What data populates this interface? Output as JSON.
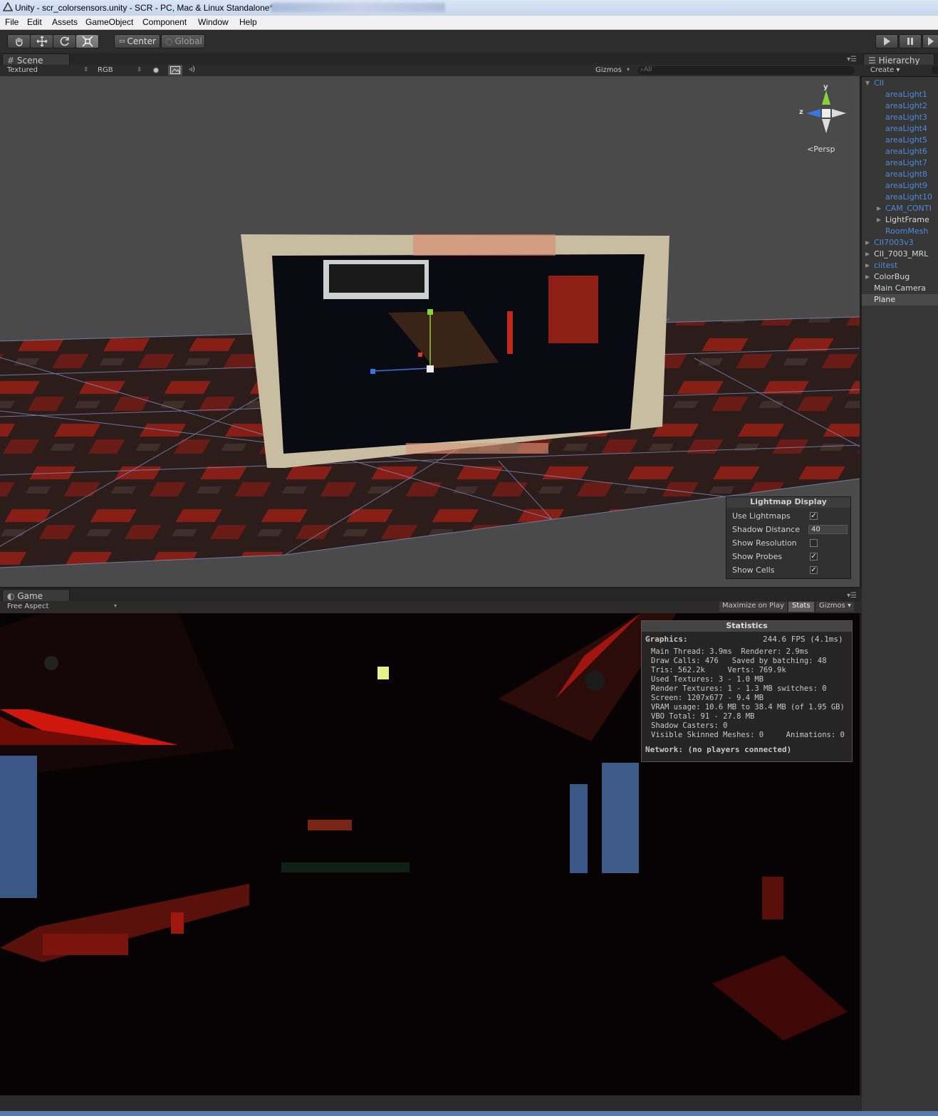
{
  "window": {
    "title": "Unity - scr_colorsensors.unity - SCR - PC, Mac & Linux Standalone*"
  },
  "menu": {
    "items": [
      "File",
      "Edit",
      "Assets",
      "GameObject",
      "Component",
      "Window",
      "Help"
    ]
  },
  "toolbar": {
    "tools": [
      "hand-icon",
      "move-icon",
      "rotate-icon",
      "scale-icon"
    ],
    "pivot_label": "Center",
    "space_label": "Global",
    "play_icon": "play-icon",
    "pause_icon": "pause-icon",
    "step_icon": "step-icon"
  },
  "scene_panel": {
    "tab_label": "Scene",
    "render_mode": "Textured",
    "color_mode": "RGB",
    "gizmos_label": "Gizmos",
    "search_placeholder": "All",
    "gizmo_y": "y",
    "gizmo_z": "z",
    "persp_label": "Persp"
  },
  "lightmap_display": {
    "title": "Lightmap Display",
    "rows": [
      {
        "label": "Use Lightmaps",
        "checked": true
      },
      {
        "label": "Shadow Distance",
        "value": "40"
      },
      {
        "label": "Show Resolution",
        "checked": false
      },
      {
        "label": "Show Probes",
        "checked": true
      },
      {
        "label": "Show Cells",
        "checked": true
      }
    ]
  },
  "hierarchy": {
    "tab_label": "Hierarchy",
    "create_label": "Create",
    "items": [
      {
        "label": "CII",
        "style": "blue",
        "indent": 0,
        "fold": "open"
      },
      {
        "label": "areaLight1",
        "style": "blue",
        "indent": 2
      },
      {
        "label": "areaLight2",
        "style": "blue",
        "indent": 2
      },
      {
        "label": "areaLight3",
        "style": "blue",
        "indent": 2
      },
      {
        "label": "areaLight4",
        "style": "blue",
        "indent": 2
      },
      {
        "label": "areaLight5",
        "style": "blue",
        "indent": 2
      },
      {
        "label": "areaLight6",
        "style": "blue",
        "indent": 2
      },
      {
        "label": "areaLight7",
        "style": "blue",
        "indent": 2
      },
      {
        "label": "areaLight8",
        "style": "blue",
        "indent": 2
      },
      {
        "label": "areaLight9",
        "style": "blue",
        "indent": 2
      },
      {
        "label": "areaLight10",
        "style": "blue",
        "indent": 2
      },
      {
        "label": "CAM_CONTI",
        "style": "blue",
        "indent": 1,
        "fold": "closed"
      },
      {
        "label": "LightFrame",
        "style": "white",
        "indent": 1,
        "fold": "closed"
      },
      {
        "label": "RoomMesh",
        "style": "blue",
        "indent": 2
      },
      {
        "label": "CII7003v3",
        "style": "blue",
        "indent": 0,
        "fold": "closed"
      },
      {
        "label": "CII_7003_MRL",
        "style": "white",
        "indent": 0,
        "fold": "closed"
      },
      {
        "label": "ciitest",
        "style": "blue",
        "indent": 0,
        "fold": "closed"
      },
      {
        "label": "ColorBug",
        "style": "white",
        "indent": 0,
        "fold": "closed"
      },
      {
        "label": "Main Camera",
        "style": "white",
        "indent": 0
      },
      {
        "label": "Plane",
        "style": "sel",
        "indent": 0
      }
    ]
  },
  "game_panel": {
    "tab_label": "Game",
    "aspect": "Free Aspect",
    "maximize_label": "Maximize on Play",
    "stats_label": "Stats",
    "gizmos_label": "Gizmos"
  },
  "statistics": {
    "title": "Statistics",
    "graphics_label": "Graphics:",
    "fps": "244.6 FPS (4.1ms)",
    "lines": [
      "Main Thread: 3.9ms  Renderer: 2.9ms",
      "Draw Calls: 476   Saved by batching: 48",
      "Tris: 562.2k     Verts: 769.9k",
      "Used Textures: 3 - 1.0 MB",
      "Render Textures: 1 - 1.3 MB switches: 0",
      "Screen: 1207x677 - 9.4 MB",
      "VRAM usage: 10.6 MB to 38.4 MB (of 1.95 GB)",
      "VBO Total: 91 - 27.8 MB",
      "Shadow Casters: 0",
      "Visible Skinned Meshes: 0     Animations: 0"
    ],
    "network_label": "Network: (no players connected)"
  },
  "colors": {
    "accent_blue": "#4d8bdc",
    "panel_bg": "#363636",
    "scene_bg": "#4a4a4a",
    "floor_red": "#b8251a"
  }
}
